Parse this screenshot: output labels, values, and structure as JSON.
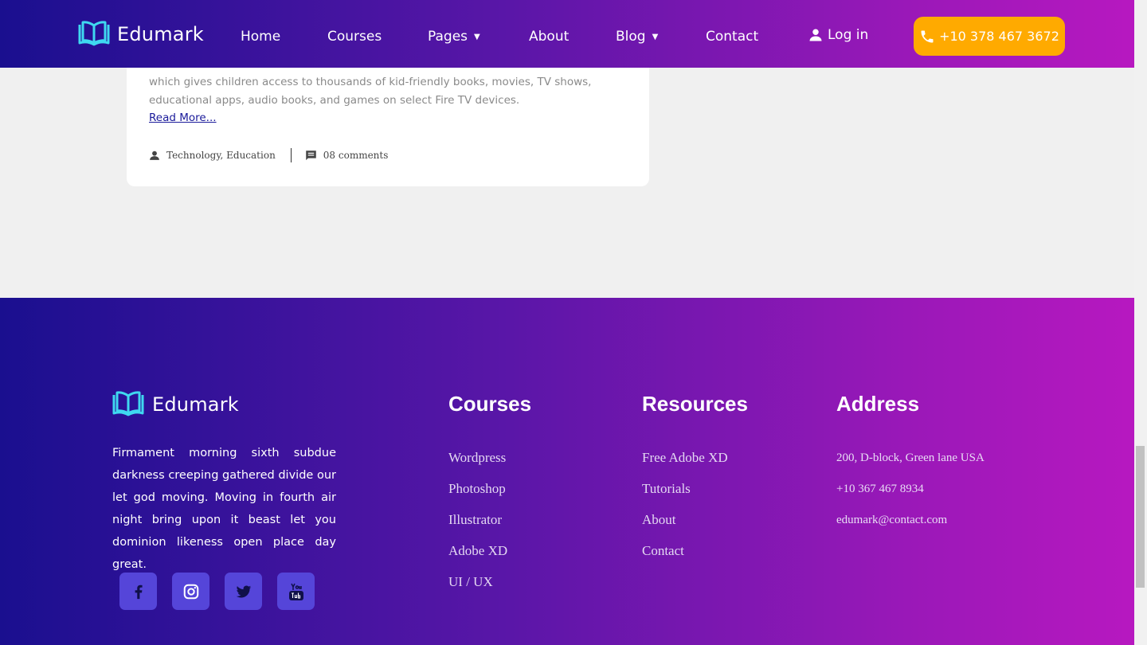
{
  "header": {
    "brand": "Edumark",
    "nav": [
      {
        "label": "Home",
        "dropdown": false
      },
      {
        "label": "Courses",
        "dropdown": false
      },
      {
        "label": "Pages",
        "dropdown": true
      },
      {
        "label": "About",
        "dropdown": false
      },
      {
        "label": "Blog",
        "dropdown": true
      },
      {
        "label": "Contact",
        "dropdown": false
      }
    ],
    "login_label": "Log in",
    "phone_label": "+10 378 467 3672",
    "caret": "▼"
  },
  "blog_card": {
    "excerpt_line1": "which gives children access to thousands of kid-friendly books, movies, TV shows,",
    "excerpt_line2": "educational apps, audio books, and games on select Fire TV devices.",
    "read_more": "Read More...",
    "categories": "Technology, Education",
    "comments": "08 comments"
  },
  "footer": {
    "brand": "Edumark",
    "about": "Firmament morning sixth subdue darkness creeping gathered divide our let god moving. Moving in fourth air night bring upon it beast let you dominion likeness open place day great.",
    "socials": [
      "facebook-icon",
      "instagram-icon",
      "twitter-icon",
      "youtube-icon"
    ],
    "courses": {
      "title": "Courses",
      "links": [
        "Wordpress",
        "Photoshop",
        "Illustrator",
        "Adobe XD",
        "UI / UX"
      ]
    },
    "resources": {
      "title": "Resources",
      "links": [
        "Free Adobe XD",
        "Tutorials",
        "About",
        "Contact"
      ]
    },
    "address": {
      "title": "Address",
      "lines": [
        "200, D-block, Green lane USA",
        "+10 367 467 8934",
        "edumark@contact.com"
      ]
    }
  },
  "colors": {
    "accent": "#ffaa00",
    "logo": "#3fd8f0",
    "gradient_start": "#1a0f8f",
    "gradient_end": "#b718c0",
    "social_bg": "#5545d9"
  }
}
